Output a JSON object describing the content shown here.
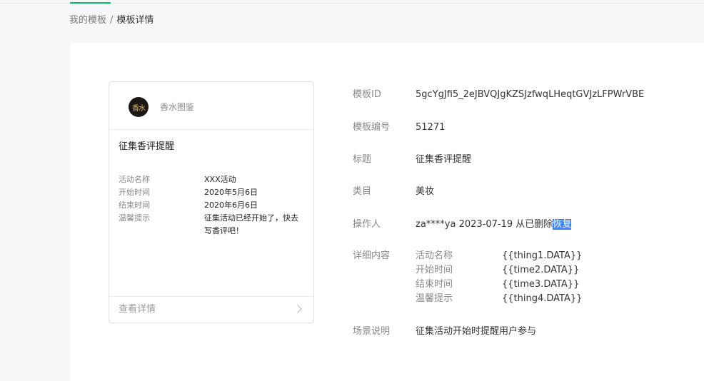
{
  "breadcrumb": {
    "parent": "我的模板",
    "separator": "/",
    "current": "模板详情"
  },
  "preview": {
    "avatar_text": "香水",
    "brand_name": "香水图鉴",
    "title": "征集香评提醒",
    "fields": [
      {
        "key": "活动名称",
        "value": "XXX活动"
      },
      {
        "key": "开始时间",
        "value": "2020年5月6日"
      },
      {
        "key": "结束时间",
        "value": "2020年6月6日"
      },
      {
        "key": "温馨提示",
        "value": "征集活动已经开始了，快去写香评吧！"
      }
    ],
    "footer_link": "查看详情",
    "chevron_icon": "chevron-right-icon"
  },
  "details": {
    "template_id": {
      "label": "模板ID",
      "value": "5gcYgJfi5_2eJBVQJgKZSJzfwqLHeqtGVJzLFPWrVBE"
    },
    "template_no": {
      "label": "模板编号",
      "value": "51271"
    },
    "title": {
      "label": "标题",
      "value": "征集香评提醒"
    },
    "category": {
      "label": "类目",
      "value": "美妆"
    },
    "operator": {
      "label": "操作人",
      "value": "za****ya 2023-07-19 从已删除",
      "action": "恢复"
    },
    "content": {
      "label": "详细内容",
      "items": [
        {
          "key": "活动名称",
          "value": "{{thing1.DATA}}"
        },
        {
          "key": "开始时间",
          "value": "{{time2.DATA}}"
        },
        {
          "key": "结束时间",
          "value": "{{time3.DATA}}"
        },
        {
          "key": "温馨提示",
          "value": "{{thing4.DATA}}"
        }
      ]
    },
    "scenario": {
      "label": "场景说明",
      "value": "征集活动开始时提醒用户参与"
    }
  },
  "colors": {
    "accent": "#07c160",
    "selection": "#3a84ff"
  }
}
